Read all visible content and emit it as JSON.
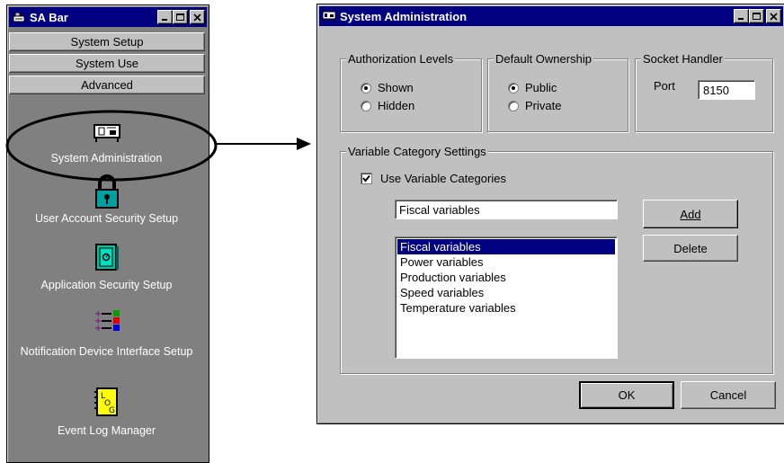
{
  "sa_bar": {
    "title": "SA Bar",
    "tabs": [
      "System Setup",
      "System Use",
      "Advanced"
    ],
    "items": [
      {
        "label": "System Administration",
        "icon": "admin-console-icon"
      },
      {
        "label": "User Account Security Setup",
        "icon": "padlock-icon"
      },
      {
        "label": "Application Security Setup",
        "icon": "safe-icon"
      },
      {
        "label": "Notification Device Interface Setup",
        "icon": "colored-list-icon"
      },
      {
        "label": "Event Log Manager",
        "icon": "log-book-icon"
      }
    ]
  },
  "dialog": {
    "title": "System Administration",
    "authorization": {
      "legend": "Authorization Levels",
      "options": [
        "Shown",
        "Hidden"
      ],
      "selected": "Shown"
    },
    "ownership": {
      "legend": "Default Ownership",
      "options": [
        "Public",
        "Private"
      ],
      "selected": "Public"
    },
    "socket": {
      "legend": "Socket Handler",
      "port_label": "Port",
      "port_value": "8150"
    },
    "variables": {
      "legend": "Variable Category Settings",
      "use_label": "Use Variable Categories",
      "use_checked": true,
      "input_value": "Fiscal variables",
      "add_label": "Add",
      "delete_label": "Delete",
      "list": [
        "Fiscal variables",
        "Power variables",
        "Production variables",
        "Speed variables",
        "Temperature variables"
      ],
      "selected": "Fiscal variables"
    },
    "ok_label": "OK",
    "cancel_label": "Cancel"
  },
  "colors": {
    "titlebar": "#000080",
    "window_face": "#c0c0c0",
    "sa_bar_body": "#808080"
  }
}
